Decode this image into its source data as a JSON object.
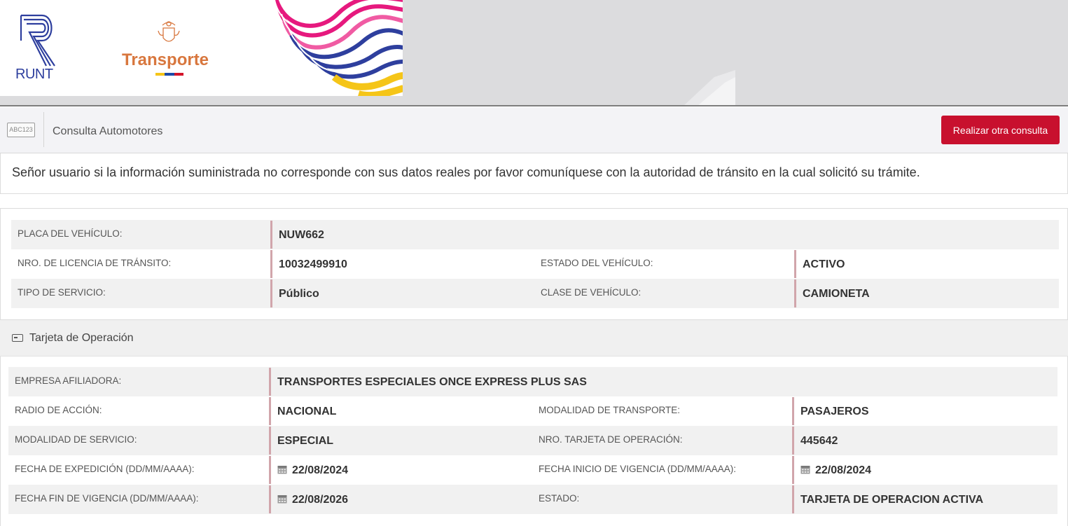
{
  "header": {
    "runt_logo_text": "RUNT",
    "ministry_logo_text": "Transporte",
    "colors": {
      "runt_blue": "#2e3f9e",
      "transporte_orange": "#d8773e",
      "flag_yellow": "#f5c518",
      "flag_blue": "#1d4aa8",
      "flag_red": "#d3142a"
    }
  },
  "titlebar": {
    "icon_text": "ABC123",
    "title": "Consulta Automotores",
    "button_label": "Realizar otra consulta",
    "button_color": "#c8102e"
  },
  "notice": "Señor usuario si la información suministrada no corresponde con sus datos reales por favor comuníquese con la autoridad de tránsito en la cual solicitó su trámite.",
  "vehicle": {
    "placa_label": "PLACA DEL VEHÍCULO:",
    "placa_value": "NUW662",
    "licencia_label": "NRO. DE LICENCIA DE TRÁNSITO:",
    "licencia_value": "10032499910",
    "estado_label": "ESTADO DEL VEHÍCULO:",
    "estado_value": "ACTIVO",
    "servicio_label": "TIPO DE SERVICIO:",
    "servicio_value": "Público",
    "clase_label": "CLASE DE VEHÍCULO:",
    "clase_value": "CAMIONETA"
  },
  "tarjeta": {
    "section_title": "Tarjeta de Operación",
    "empresa_label": "EMPRESA AFILIADORA:",
    "empresa_value": "TRANSPORTES ESPECIALES ONCE EXPRESS PLUS SAS",
    "radio_label": "RADIO DE ACCIÓN:",
    "radio_value": "NACIONAL",
    "modalidad_transporte_label": "MODALIDAD DE TRANSPORTE:",
    "modalidad_transporte_value": "PASAJEROS",
    "modalidad_servicio_label": "MODALIDAD DE SERVICIO:",
    "modalidad_servicio_value": "ESPECIAL",
    "nro_tarjeta_label": "NRO. TARJETA DE OPERACIÓN:",
    "nro_tarjeta_value": "445642",
    "fecha_expedicion_label": "FECHA DE EXPEDICIÓN (DD/MM/AAAA):",
    "fecha_expedicion_value": "22/08/2024",
    "fecha_inicio_label": "FECHA INICIO DE VIGENCIA (DD/MM/AAAA):",
    "fecha_inicio_value": "22/08/2024",
    "fecha_fin_label": "FECHA FIN DE VIGENCIA (DD/MM/AAAA):",
    "fecha_fin_value": "22/08/2026",
    "estado_label": "ESTADO:",
    "estado_value": "TARJETA DE OPERACION ACTIVA"
  },
  "icons": {
    "calendar": "calendar-icon",
    "card": "card-icon",
    "plate": "plate-icon"
  }
}
